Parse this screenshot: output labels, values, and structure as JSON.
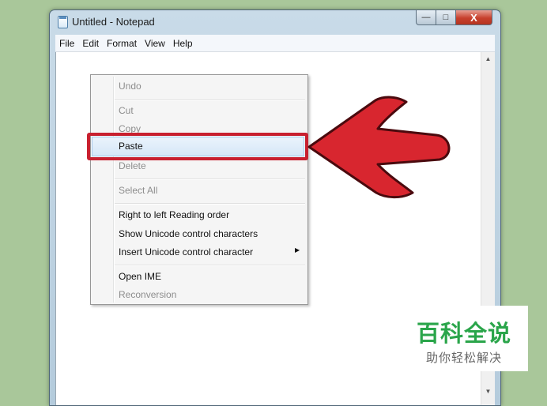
{
  "window": {
    "title": "Untitled - Notepad",
    "min_glyph": "—",
    "max_glyph": "□",
    "close_glyph": "X"
  },
  "menubar": [
    "File",
    "Edit",
    "Format",
    "View",
    "Help"
  ],
  "context_menu": {
    "undo": "Undo",
    "cut": "Cut",
    "copy": "Copy",
    "paste": "Paste",
    "delete": "Delete",
    "select_all": "Select All",
    "rtl": "Right to left Reading order",
    "show_unicode": "Show Unicode control characters",
    "insert_unicode": "Insert Unicode control character",
    "open_ime": "Open IME",
    "reconversion": "Reconversion",
    "highlighted_item": "Paste"
  },
  "colors": {
    "highlight_red": "#c8202f",
    "arrow_red": "#d8262f",
    "watermark_green": "#2aa54a"
  },
  "watermark": {
    "title": "百科全说",
    "subtitle": "助你轻松解决"
  }
}
